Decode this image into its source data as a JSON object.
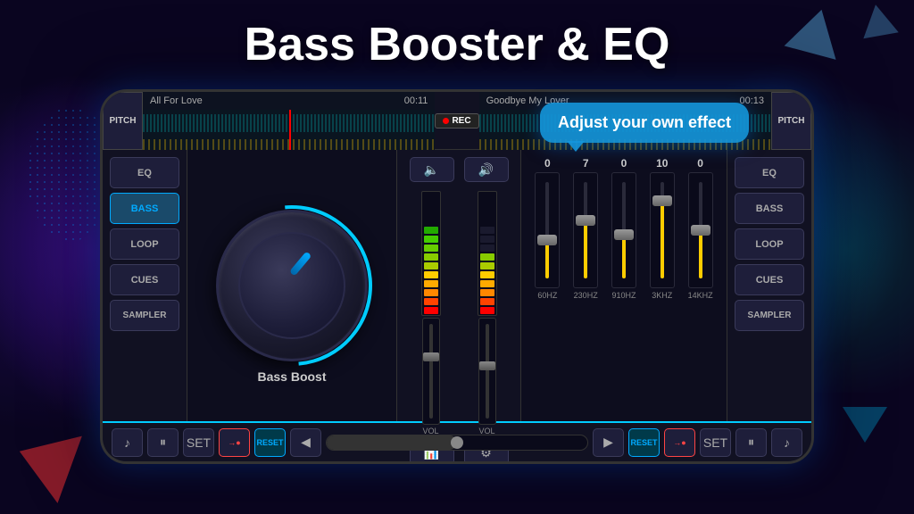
{
  "title": "Bass Booster & EQ",
  "tooltip": "Adjust your own effect",
  "header": {
    "left_track": "All For Love",
    "left_time": "00:11",
    "rec_label": "REC",
    "right_track": "Goodbye My Lover",
    "right_time": "00:13",
    "pitch_label": "PITCH"
  },
  "left_panel": {
    "eq": "EQ",
    "bass": "BASS",
    "loop": "LOOP",
    "cues": "CUES",
    "sampler": "SAMPLER"
  },
  "right_panel": {
    "eq": "EQ",
    "bass": "BASS",
    "loop": "LOOP",
    "cues": "CUES",
    "sampler": "SAMPLER"
  },
  "knob": {
    "label": "Bass Boost"
  },
  "mixer": {
    "vol_label_left": "VOL",
    "vol_label_right": "VOL"
  },
  "eq": {
    "bands": [
      {
        "freq": "60HZ",
        "value": "0",
        "position": 55
      },
      {
        "freq": "230HZ",
        "value": "7",
        "position": 35
      },
      {
        "freq": "910HZ",
        "value": "0",
        "position": 50
      },
      {
        "freq": "3KHZ",
        "value": "10",
        "position": 20
      },
      {
        "freq": "14KHZ",
        "value": "0",
        "position": 45
      }
    ]
  },
  "transport": {
    "music_icon": "♪",
    "pause_icon": "⏸",
    "set_label": "SET",
    "reset_label": "RESET",
    "prev_icon": "◀",
    "next_icon": "▶",
    "pause2_icon": "⏸",
    "music2_icon": "♪"
  }
}
